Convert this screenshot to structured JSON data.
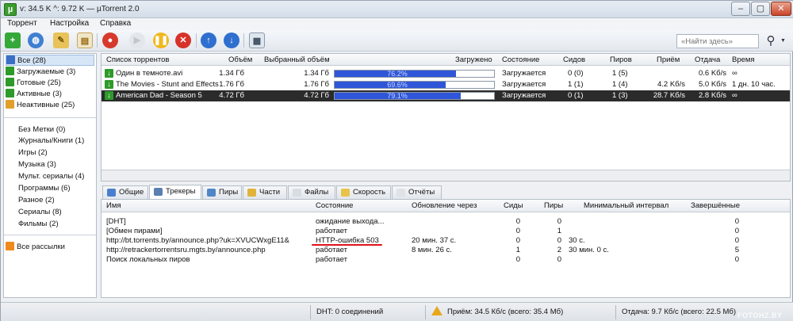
{
  "window": {
    "title": "v: 34.5 K ^: 9.72 K — µTorrent 2.0",
    "app_icon": "µ"
  },
  "menu": [
    "Торрент",
    "Настройка",
    "Справка"
  ],
  "toolbar": {
    "buttons": [
      "add-torrent",
      "add-url",
      "create-torrent",
      "rss",
      "remove",
      "start",
      "pause",
      "stop",
      "move-up",
      "move-down",
      "preferences"
    ],
    "search_placeholder": "«Найти здесь»"
  },
  "sidebar": {
    "status": [
      {
        "label": "Все (28)",
        "color": "#3b6fc6"
      },
      {
        "label": "Загружаемые (3)",
        "color": "#2e9a2a"
      },
      {
        "label": "Готовые (25)",
        "color": "#2e9a2a"
      },
      {
        "label": "Активные (3)",
        "color": "#2e9a2a"
      },
      {
        "label": "Неактивные (25)",
        "color": "#e0a02a"
      }
    ],
    "labels": [
      "Без Метки (0)",
      "Журналы/Книги (1)",
      "Игры (2)",
      "Музыка (3)",
      "Мульт. сериалы (4)",
      "Программы (6)",
      "Разное (2)",
      "Сериалы (8)",
      "Фильмы (2)"
    ],
    "feeds": "Все рассылки"
  },
  "torrents": {
    "columns": [
      "Список торрентов",
      "Объём",
      "Выбранный объём",
      "Загружено",
      "Состояние",
      "Сидов",
      "Пиров",
      "Приём",
      "Отдача",
      "Время"
    ],
    "rows": [
      {
        "name": "Один в темноте.avi",
        "size": "1.34 Гб",
        "selected_size": "1.34 Гб",
        "done": "76.2%",
        "progress": 0.762,
        "status": "Загружается",
        "seeds": "0 (0)",
        "peers": "1 (5)",
        "down": "",
        "up": "0.6 Kб/s",
        "eta": "∞"
      },
      {
        "name": "The Movies - Stunt and Effects",
        "size": "1.76 Гб",
        "selected_size": "1.76 Гб",
        "done": "69.6%",
        "progress": 0.696,
        "status": "Загружается",
        "seeds": "1 (1)",
        "peers": "1 (4)",
        "down": "4.2 Kб/s",
        "up": "5.0 Kб/s",
        "eta": "1 дн. 10 час."
      },
      {
        "name": "American Dad - Season 5",
        "size": "4.72 Гб",
        "selected_size": "4.72 Гб",
        "done": "79.1%",
        "progress": 0.791,
        "status": "Загружается",
        "seeds": "0 (1)",
        "peers": "1 (3)",
        "down": "28.7 Kб/s",
        "up": "2.8 Kб/s",
        "eta": "∞"
      }
    ]
  },
  "tabs": [
    "Общие",
    "Трекеры",
    "Пиры",
    "Части",
    "Файлы",
    "Скорость",
    "Отчёты"
  ],
  "trackers": {
    "columns": [
      "Имя",
      "Состояние",
      "Обновление через",
      "Сиды",
      "Пиры",
      "Минимальный интервал",
      "Завершённые"
    ],
    "rows": [
      {
        "name": "[DHT]",
        "status": "ожидание выхода...",
        "update": "",
        "seeds": "0",
        "peers": "0",
        "min_interval": "",
        "done": "0"
      },
      {
        "name": "[Обмен пирами]",
        "status": "работает",
        "update": "",
        "seeds": "0",
        "peers": "1",
        "min_interval": "",
        "done": "0"
      },
      {
        "name": "http://bt.torrents.by/announce.php?uk=XVUCWxgE11&",
        "status": "HTTP-ошибка 503",
        "update": "20 мин. 37 с.",
        "seeds": "0",
        "peers": "0",
        "min_interval": "30 с.",
        "done": "0"
      },
      {
        "name": "http://retrackertorrentsru.mgts.by/announce.php",
        "status": "работает",
        "update": "8 мин. 26 с.",
        "seeds": "1",
        "peers": "2",
        "min_interval": "30 мин. 0 с.",
        "done": "5"
      },
      {
        "name": "Поиск локальных пиров",
        "status": "работает",
        "update": "",
        "seeds": "0",
        "peers": "0",
        "min_interval": "",
        "done": "0"
      }
    ]
  },
  "statusbar": {
    "dht": "DHT: 0 соединений",
    "down": "Приём: 34.5 Кб/с (всего: 35.4 Мб)",
    "up": "Отдача: 9.7 Кб/с (всего: 22.5 Мб)"
  },
  "watermark": "FOTOHZ.BY"
}
